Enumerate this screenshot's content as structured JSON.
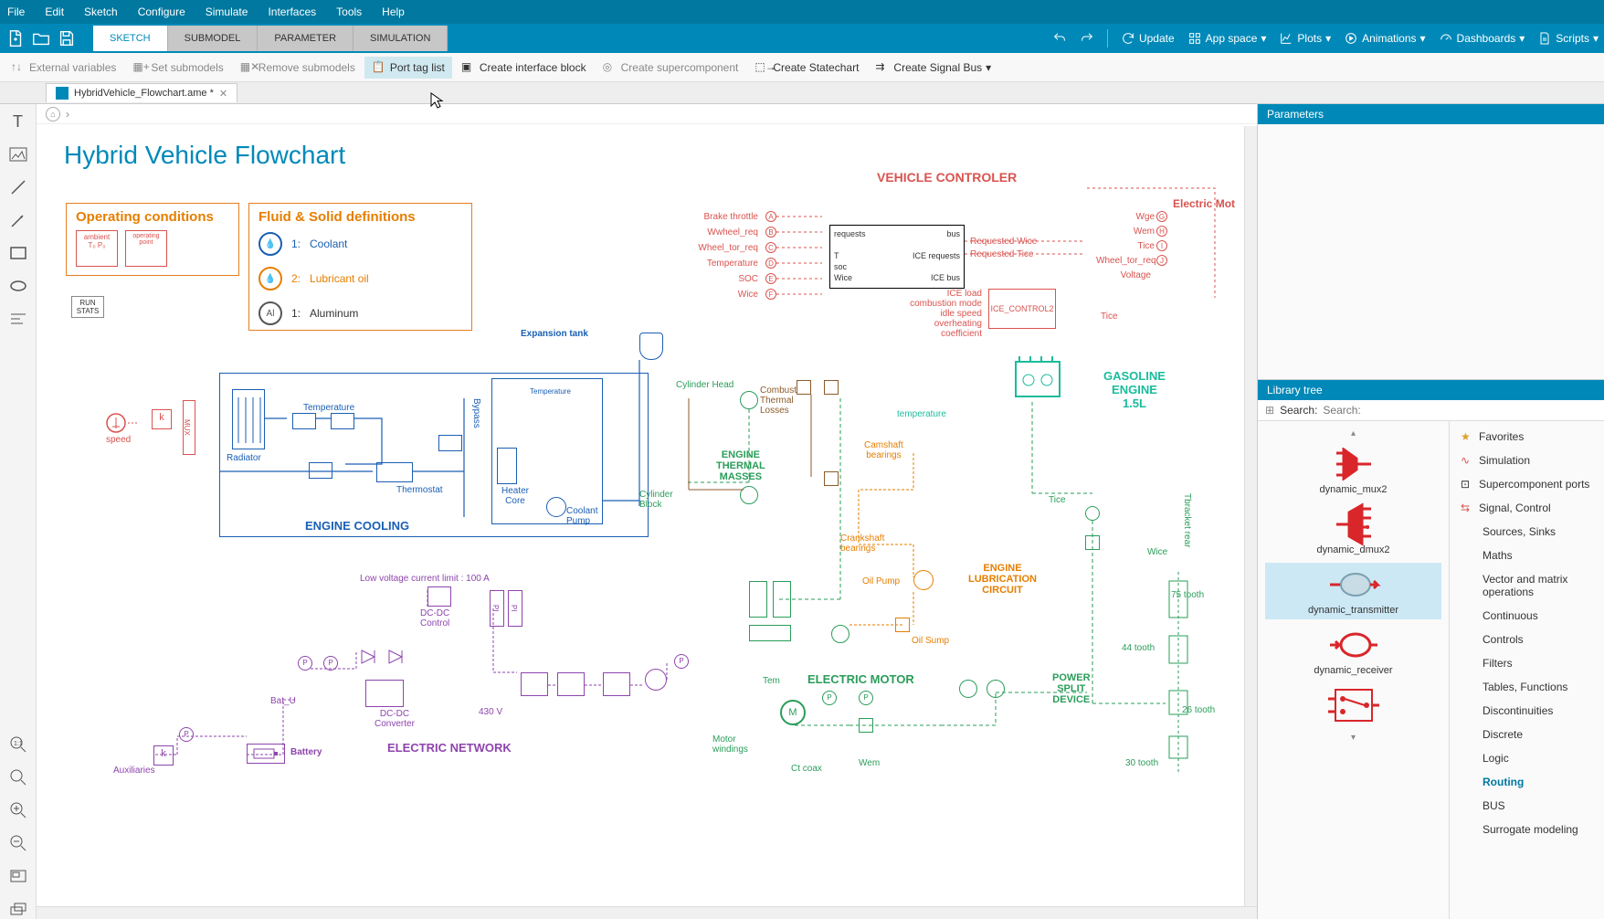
{
  "menubar": [
    "File",
    "Edit",
    "Sketch",
    "Configure",
    "Simulate",
    "Interfaces",
    "Tools",
    "Help"
  ],
  "tabs": [
    "SKETCH",
    "SUBMODEL",
    "PARAMETER",
    "SIMULATION"
  ],
  "active_tab": 0,
  "ribbon_right": {
    "update": "Update",
    "appspace": "App space",
    "plots": "Plots",
    "animations": "Animations",
    "dashboards": "Dashboards",
    "scripts": "Scripts"
  },
  "toolbar": {
    "ext_vars": "External variables",
    "set_sub": "Set submodels",
    "rem_sub": "Remove submodels",
    "port_tag": "Port tag list",
    "create_if": "Create interface block",
    "create_super": "Create supercomponent",
    "create_statechart": "Create Statechart",
    "create_signalbus": "Create Signal Bus"
  },
  "filetab": {
    "name": "HybridVehicle_Flowchart.ame *"
  },
  "canvas": {
    "title": "Hybrid Vehicle Flowchart",
    "op_cond": "Operating conditions",
    "op_items": {
      "ambient": "ambient",
      "oppoint": "operating\npoint"
    },
    "fluid_title": "Fluid & Solid definitions",
    "fluids": [
      {
        "num": "1:",
        "name": "Coolant",
        "color": "#1a5fb4"
      },
      {
        "num": "2:",
        "name": "Lubricant oil",
        "color": "#e67e00"
      },
      {
        "num": "1:",
        "name": "Aluminum",
        "color": "#555",
        "mark": "Al"
      }
    ],
    "run_stats": "RUN\nSTATS",
    "expansion_tank": "Expansion tank",
    "speed": "speed",
    "radiator": "Radiator",
    "thermostat": "Thermostat",
    "heater": "Heater\nCore",
    "coolant_pump": "Coolant\nPump",
    "temperature": "Temperature",
    "engine_cooling": "ENGINE COOLING",
    "cyl_head": "Cylinder Head",
    "cyl_block": "Cylinder\nBlock",
    "etm": "ENGINE\nTHERMAL\nMASSES",
    "combustion": "Combustion\nThermal\nLosses",
    "camshaft": "Camshaft\nbearings",
    "crankshaft": "Crankshaft\nbearings",
    "oil_pump": "Oil Pump",
    "oil_sump": "Oil Sump",
    "elc": "ENGINE\nLUBRICATION\nCIRCUIT",
    "vehicle_controller": "VEHICLE CONTROLER",
    "brake_throttle": "Brake throttle",
    "wwheel_req": "Wwheel_req",
    "wheel_tor_req": "Wheel_tor_req",
    "temp_sig": "Temperature",
    "soc": "SOC",
    "wice": "Wice",
    "bus": "bus",
    "requests": "requests",
    "ice_requests": "ICE requests",
    "ice_bus": "ICE bus",
    "req_wice": "Requested Wice",
    "req_tice": "Requested Tice",
    "ice_load": "ICE load",
    "combustion_mode": "combustion mode",
    "idle_speed": "idle speed",
    "overheat": "overheating coefficient",
    "ice_control": "ICE_CONTROL2",
    "electric_motor_hdr": "Electric Mot",
    "wge": "Wge",
    "wem": "Wem",
    "tice_req": "Tice",
    "gasoline": "GASOLINE\nENGINE\n1.5L",
    "temperature2": "temperature",
    "tice": "Tice",
    "tbracket": "Tbracket rear",
    "pwrsplitn": "POWER\nSPLIT\nDEVICE",
    "tooth75": "75 tooth",
    "tooth44": "44 tooth",
    "tooth26": "26 tooth",
    "tooth30": "30 tooth",
    "em": "ELECTRIC MOTOR",
    "motor_windings": "Motor\nwindings",
    "tem": "Tem",
    "wem2": "Wem",
    "ctcoax": "Ct coax",
    "elec_net": "ELECTRIC NETWORK",
    "dcdc_control": "DC-DC\nControl",
    "dcdc_conv": "DC-DC\nConverter",
    "bat": "Battery",
    "bat_u": "Bat_U",
    "aux": "Auxiliaries",
    "lv_limit": "Low voltage current limit : 100 A",
    "v430": "430 V",
    "voltage": "Voltage",
    "soc_bus": "soc",
    "t_bus": "T",
    "wice_bus": "Wice",
    "ports_left": [
      "A",
      "B",
      "C",
      "D",
      "E",
      "F"
    ],
    "ports_right": [
      "G",
      "H",
      "I",
      "J"
    ]
  },
  "right": {
    "parameters": "Parameters",
    "library_tree": "Library tree",
    "search_label": "Search:",
    "lib_items": [
      {
        "name": "dynamic_mux2"
      },
      {
        "name": "dynamic_dmux2"
      },
      {
        "name": "dynamic_transmitter",
        "selected": true
      },
      {
        "name": "dynamic_receiver"
      },
      {
        "name": ""
      }
    ],
    "categories": [
      {
        "name": "Favorites",
        "icon": "star"
      },
      {
        "name": "Simulation",
        "icon": "sim"
      },
      {
        "name": "Supercomponent ports",
        "icon": "ports"
      },
      {
        "name": "Signal, Control",
        "icon": "signal"
      },
      {
        "name": "Sources, Sinks",
        "indent": true
      },
      {
        "name": "Maths",
        "indent": true
      },
      {
        "name": "Vector and matrix operations",
        "indent": true
      },
      {
        "name": "Continuous",
        "indent": true
      },
      {
        "name": "Controls",
        "indent": true
      },
      {
        "name": "Filters",
        "indent": true
      },
      {
        "name": "Tables, Functions",
        "indent": true
      },
      {
        "name": "Discontinuities",
        "indent": true
      },
      {
        "name": "Discrete",
        "indent": true
      },
      {
        "name": "Logic",
        "indent": true
      },
      {
        "name": "Routing",
        "indent": true,
        "active": true
      },
      {
        "name": "BUS",
        "indent": true
      },
      {
        "name": "Surrogate modeling",
        "indent": true
      }
    ]
  }
}
